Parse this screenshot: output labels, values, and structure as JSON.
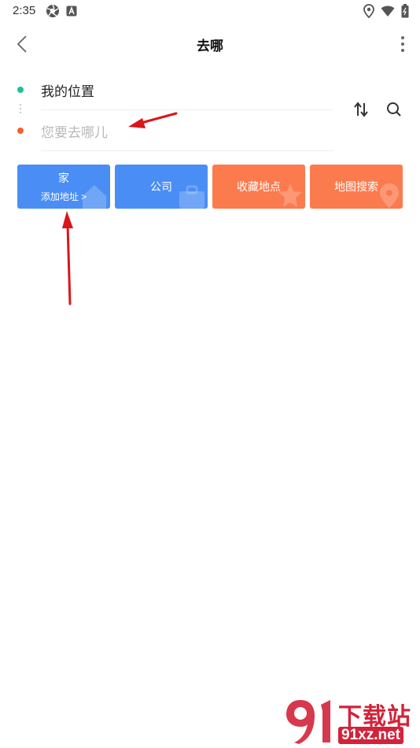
{
  "status_bar": {
    "time": "2:35"
  },
  "header": {
    "title": "去哪"
  },
  "route": {
    "start_value": "我的位置",
    "destination_placeholder": "您要去哪儿"
  },
  "shortcuts": [
    {
      "label": "家",
      "sub": "添加地址 >",
      "color": "#4a8ef5"
    },
    {
      "label": "公司",
      "color": "#4a8ef5"
    },
    {
      "label": "收藏地点",
      "color": "#fb7b4f"
    },
    {
      "label": "地图搜索",
      "color": "#fb7b4f"
    }
  ],
  "colors": {
    "start_dot": "#1fc09b",
    "end_dot": "#f1622e",
    "annotation_arrow": "#d9161c"
  },
  "watermark": {
    "brand": "下载站",
    "domain": "91xz.net"
  }
}
